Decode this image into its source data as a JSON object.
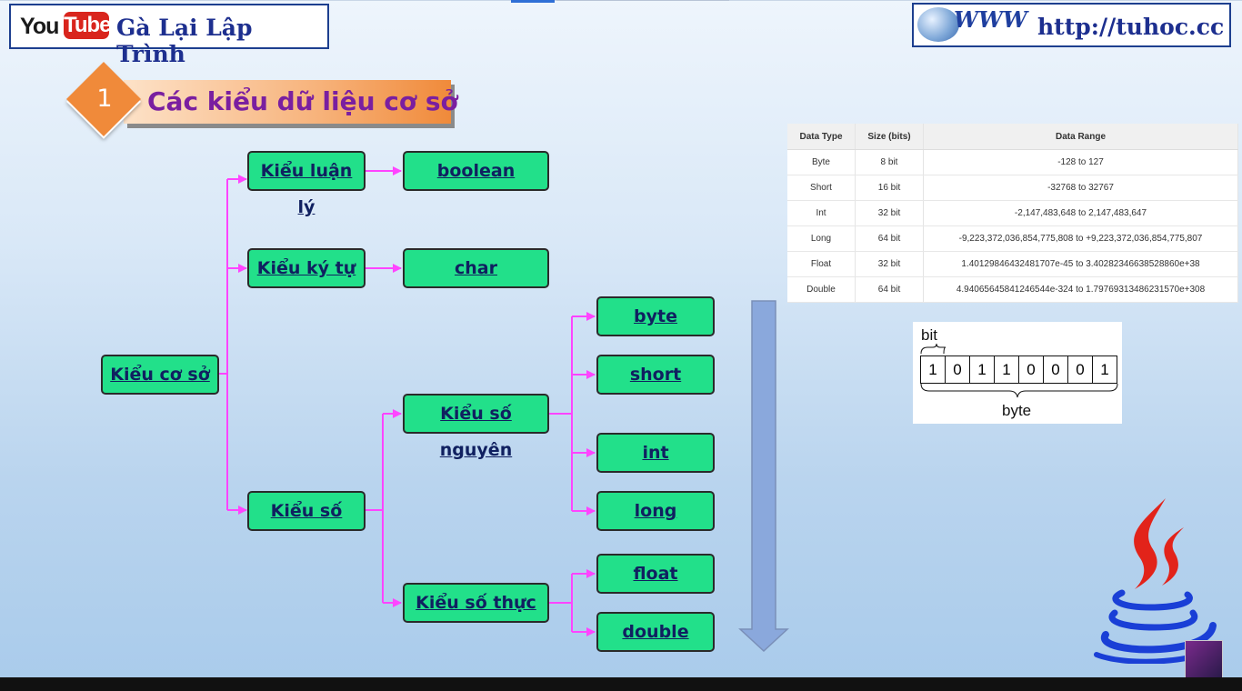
{
  "header": {
    "youtube_you": "You",
    "youtube_tube": "Tube",
    "channel_name": "Gà Lại Lập Trình",
    "www_text": "WWW",
    "url": "http://tuhoc.cc"
  },
  "section": {
    "number": "1",
    "title": "Các kiểu dữ liệu cơ sở"
  },
  "tree": {
    "root": "Kiểu cơ sở",
    "logical": "Kiểu luận lý",
    "boolean": "boolean",
    "character": "Kiểu ký tự",
    "char": "char",
    "numeric": "Kiểu số",
    "integer": "Kiểu số nguyên",
    "byte": "byte",
    "short": "short",
    "int": "int",
    "long": "long",
    "real": "Kiểu số thực",
    "float": "float",
    "double": "double"
  },
  "table": {
    "headers": [
      "Data Type",
      "Size (bits)",
      "Data Range"
    ],
    "rows": [
      [
        "Byte",
        "8 bit",
        "-128 to 127"
      ],
      [
        "Short",
        "16 bit",
        "-32768 to 32767"
      ],
      [
        "Int",
        "32 bit",
        "-2,147,483,648 to 2,147,483,647"
      ],
      [
        "Long",
        "64 bit",
        "-9,223,372,036,854,775,808 to +9,223,372,036,854,775,807"
      ],
      [
        "Float",
        "32 bit",
        "1.40129846432481707e-45 to 3.40282346638528860e+38"
      ],
      [
        "Double",
        "64 bit",
        "4.94065645841246544e-324 to 1.79769313486231570e+308"
      ]
    ]
  },
  "bit_figure": {
    "bit_label": "bit",
    "bits": [
      "1",
      "0",
      "1",
      "1",
      "0",
      "0",
      "0",
      "1"
    ],
    "byte_label": "byte"
  },
  "colors": {
    "node_fill": "#22e08a",
    "connector": "#ff44ff",
    "arrow_fill": "#8aa8dc",
    "badge_orange": "#f08a3a",
    "title_purple": "#7a1fa0"
  },
  "icons": {
    "logo_java": "java-logo-icon",
    "logo_www": "www-globe-icon"
  }
}
